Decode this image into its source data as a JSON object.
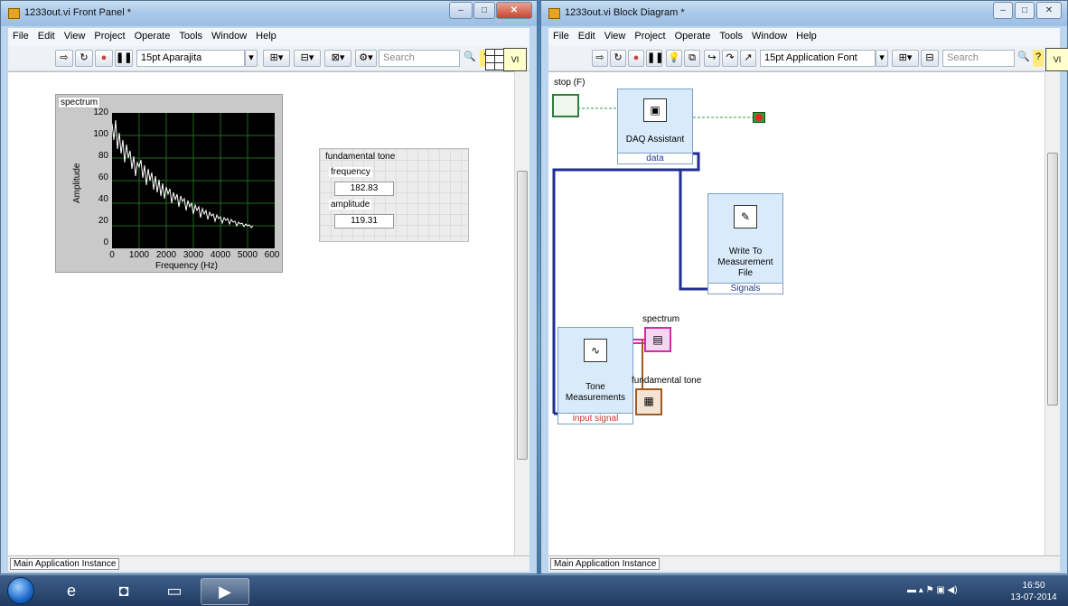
{
  "front_panel": {
    "title": "1233out.vi Front Panel *",
    "menu": [
      "File",
      "Edit",
      "View",
      "Project",
      "Operate",
      "Tools",
      "Window",
      "Help"
    ],
    "font_select": "15pt Aparajita",
    "search_placeholder": "Search",
    "graph": {
      "label": "spectrum",
      "y_ticks": [
        "120",
        "100",
        "80",
        "60",
        "40",
        "20",
        "0"
      ],
      "x_ticks": [
        "0",
        "1000",
        "2000",
        "3000",
        "4000",
        "5000",
        "600"
      ],
      "x_label": "Frequency (Hz)",
      "y_label": "Amplitude"
    },
    "cluster": {
      "title": "fundamental tone",
      "frequency_label": "frequency",
      "frequency_value": "182.83",
      "amplitude_label": "amplitude",
      "amplitude_value": "119.31"
    },
    "status": "Main Application Instance"
  },
  "block_diagram": {
    "title": "1233out.vi Block Diagram *",
    "menu": [
      "File",
      "Edit",
      "View",
      "Project",
      "Operate",
      "Tools",
      "Window",
      "Help"
    ],
    "font_select": "15pt Application Font",
    "search_placeholder": "Search",
    "stop_label": "stop (F)",
    "daq": {
      "label": "DAQ Assistant",
      "output": "data"
    },
    "write": {
      "line1": "Write To",
      "line2": "Measurement",
      "line3": "File",
      "input": "Signals"
    },
    "tone": {
      "line1": "Tone",
      "line2": "Measurements",
      "input": "input signal"
    },
    "spectrum_terminal": "spectrum",
    "fundamental_terminal": "fundamental tone",
    "status": "Main Application Instance"
  },
  "taskbar": {
    "time": "16:50",
    "date": "13-07-2014"
  },
  "colors": {
    "wire_blue": "#1f2e8f",
    "wire_green": "#2e9d3b",
    "wire_pink": "#d42aa6",
    "wire_brown": "#a15a1f"
  }
}
